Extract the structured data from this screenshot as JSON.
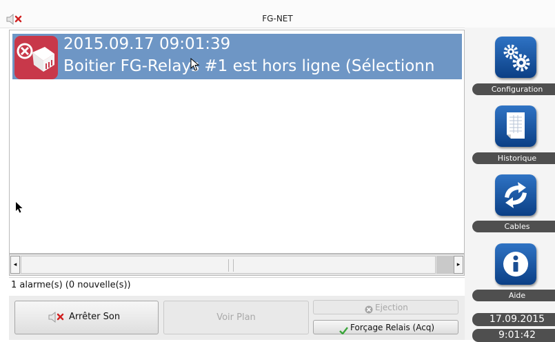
{
  "window": {
    "title": "FG-NET"
  },
  "alarms": [
    {
      "timestamp": "2015.09.17 09:01:39",
      "message": "Boitier FG-Relays #1 est hors ligne (Sélectionn",
      "icon": "offline-relay-icon"
    }
  ],
  "status": {
    "text": "1 alarme(s) (0 nouvelle(s))"
  },
  "buttons": {
    "stop_sound": "Arrêter Son",
    "view_plan": "Voir Plan",
    "ejection": "Ejection",
    "force_relay": "Forçage Relais (Acq)"
  },
  "sidebar": {
    "items": [
      {
        "label": "Configuration",
        "icon": "gears-icon"
      },
      {
        "label": "Historique",
        "icon": "document-icon"
      },
      {
        "label": "Cables",
        "icon": "cables-sync-icon"
      },
      {
        "label": "Aide",
        "icon": "info-icon"
      }
    ],
    "date": "17.09.2015",
    "time": "9:01:42"
  },
  "colors": {
    "selection": "#6e96c5",
    "alarm_icon_bg": "#c8384a",
    "sidebar_button": "#1f5aa8",
    "sidebar_label_bg": "#4f4f4f"
  }
}
